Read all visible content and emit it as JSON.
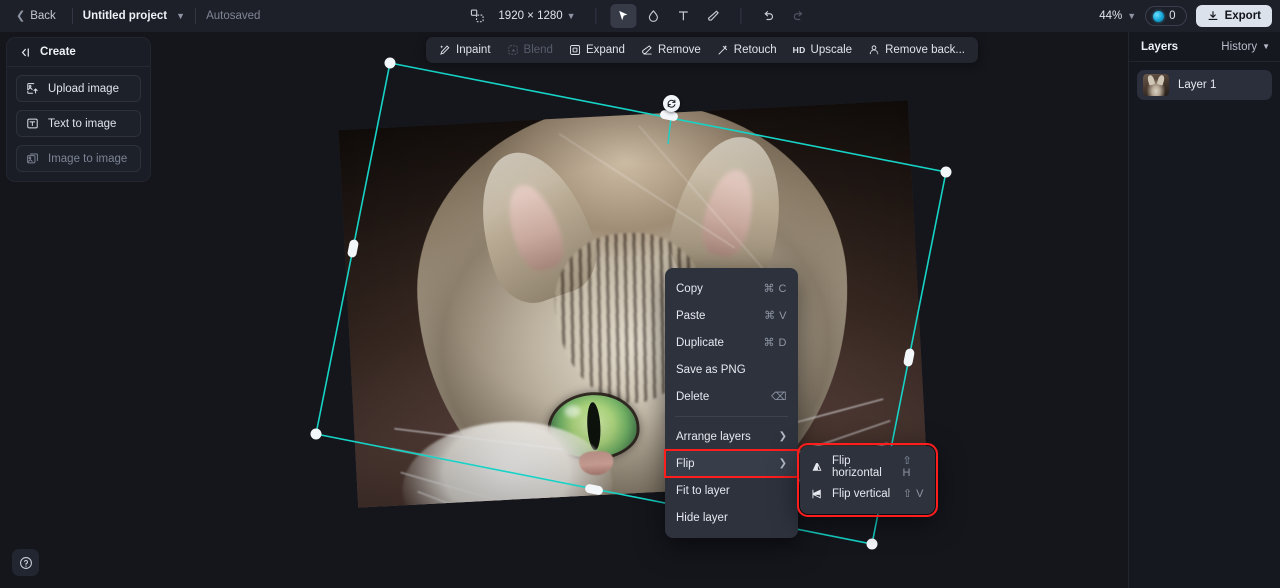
{
  "topbar": {
    "back_label": "Back",
    "project_name": "Untitled project",
    "autosaved_label": "Autosaved",
    "canvas_size": "1920 × 1280",
    "zoom_level": "44%",
    "credits": "0",
    "export_label": "Export",
    "tools": [
      {
        "name": "canvas-size-icon",
        "title": "Canvas size"
      },
      {
        "name": "select-tool",
        "title": "Select",
        "active": true
      },
      {
        "name": "brush-mask-tool",
        "title": "Mask brush",
        "active": false
      },
      {
        "name": "text-tool",
        "title": "Text",
        "active": false
      },
      {
        "name": "eraser-tool",
        "title": "Eraser",
        "active": false
      },
      {
        "name": "undo-button",
        "title": "Undo",
        "active": false
      },
      {
        "name": "redo-button",
        "title": "Redo",
        "active": false
      }
    ]
  },
  "left_panel": {
    "title": "Create",
    "items": [
      {
        "label": "Upload image",
        "icon": "upload-image-icon",
        "disabled": false
      },
      {
        "label": "Text to image",
        "icon": "text-to-image-icon",
        "disabled": false
      },
      {
        "label": "Image to image",
        "icon": "image-to-image-icon",
        "disabled": true
      }
    ]
  },
  "tool_strip": {
    "items": [
      {
        "label": "Inpaint",
        "icon": "inpaint-icon",
        "disabled": false
      },
      {
        "label": "Blend",
        "icon": "blend-icon",
        "disabled": true
      },
      {
        "label": "Expand",
        "icon": "expand-icon",
        "disabled": false
      },
      {
        "label": "Remove",
        "icon": "remove-icon",
        "disabled": false
      },
      {
        "label": "Retouch",
        "icon": "retouch-icon",
        "disabled": false
      },
      {
        "label": "Upscale",
        "icon": "hd-icon",
        "disabled": false,
        "badge": "HD"
      },
      {
        "label": "Remove back...",
        "icon": "remove-background-icon",
        "disabled": false
      }
    ]
  },
  "right_panel": {
    "title": "Layers",
    "history_label": "History",
    "layers": [
      {
        "name": "Layer 1",
        "selected": true
      }
    ]
  },
  "context_menu": {
    "groups": [
      [
        {
          "label": "Copy",
          "shortcut": "⌘ C",
          "submenu": false
        },
        {
          "label": "Paste",
          "shortcut": "⌘ V",
          "submenu": false
        },
        {
          "label": "Duplicate",
          "shortcut": "⌘ D",
          "submenu": false
        },
        {
          "label": "Save as PNG",
          "shortcut": "",
          "submenu": false
        },
        {
          "label": "Delete",
          "shortcut": "⌫",
          "submenu": false
        }
      ],
      [
        {
          "label": "Arrange layers",
          "shortcut": "",
          "submenu": true,
          "highlighted": false
        },
        {
          "label": "Flip",
          "shortcut": "",
          "submenu": true,
          "highlighted": true
        },
        {
          "label": "Fit to layer",
          "shortcut": "",
          "submenu": false
        },
        {
          "label": "Hide layer",
          "shortcut": "",
          "submenu": false
        }
      ]
    ]
  },
  "flip_submenu": {
    "items": [
      {
        "label": "Flip horizontal",
        "shortcut": "⇧ H",
        "icon": "flip-horizontal-icon"
      },
      {
        "label": "Flip vertical",
        "shortcut": "⇧ V",
        "icon": "flip-vertical-icon"
      }
    ]
  },
  "help": {
    "icon": "help-icon"
  },
  "colors": {
    "accent_selection": "#16d3c6",
    "highlight_outline": "#ff1d1d",
    "export_bg": "#dbe2ec",
    "canvas_bg": "#14161c",
    "topbar_bg": "#1e2029",
    "menu_bg": "#2d323d"
  }
}
